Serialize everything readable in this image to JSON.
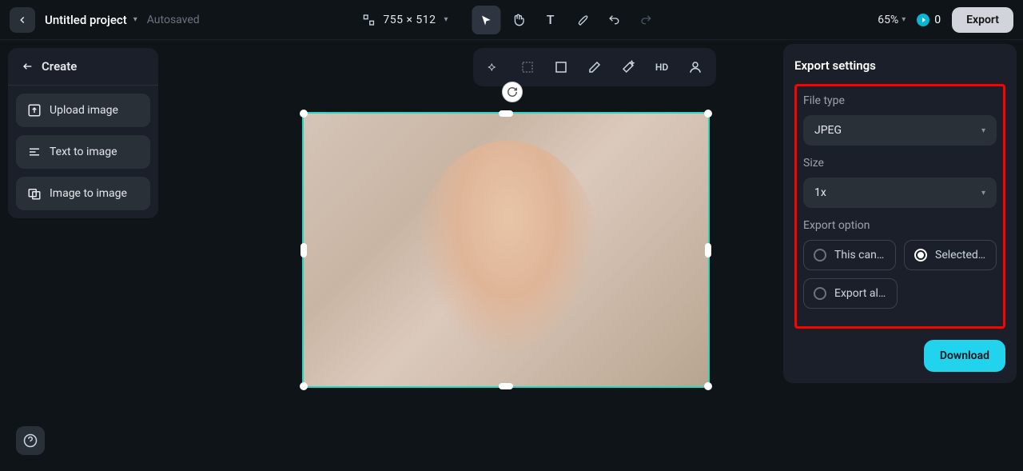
{
  "header": {
    "project_title": "Untitled project",
    "autosaved": "Autosaved",
    "dimensions": "755 × 512",
    "zoom": "65%",
    "credits": "0",
    "export_label": "Export",
    "icons": {
      "back": "chevron-left",
      "resize": "resize-icon",
      "cursor": "cursor-icon",
      "hand": "hand-icon",
      "text": "text-icon",
      "brush": "brush-icon",
      "undo": "undo-icon",
      "redo": "redo-icon"
    }
  },
  "sidebar": {
    "create_label": "Create",
    "items": [
      {
        "label": "Upload image",
        "icon": "upload-icon"
      },
      {
        "label": "Text to image",
        "icon": "text-to-image-icon"
      },
      {
        "label": "Image to image",
        "icon": "image-to-image-icon"
      }
    ]
  },
  "canvas_toolbar": {
    "items": [
      {
        "name": "magic-select-icon"
      },
      {
        "name": "crop-icon"
      },
      {
        "name": "frame-icon"
      },
      {
        "name": "eraser-icon"
      },
      {
        "name": "magic-wand-icon"
      },
      {
        "name": "hd-label",
        "label": "HD"
      },
      {
        "name": "person-icon"
      }
    ]
  },
  "export_panel": {
    "title": "Export settings",
    "file_type_label": "File type",
    "file_type_value": "JPEG",
    "size_label": "Size",
    "size_value": "1x",
    "export_option_label": "Export option",
    "options": {
      "this_canvas": "This canvas",
      "selected": "Selected l…",
      "export_all": "Export all …"
    },
    "download_label": "Download"
  },
  "help_icon": "question-icon"
}
